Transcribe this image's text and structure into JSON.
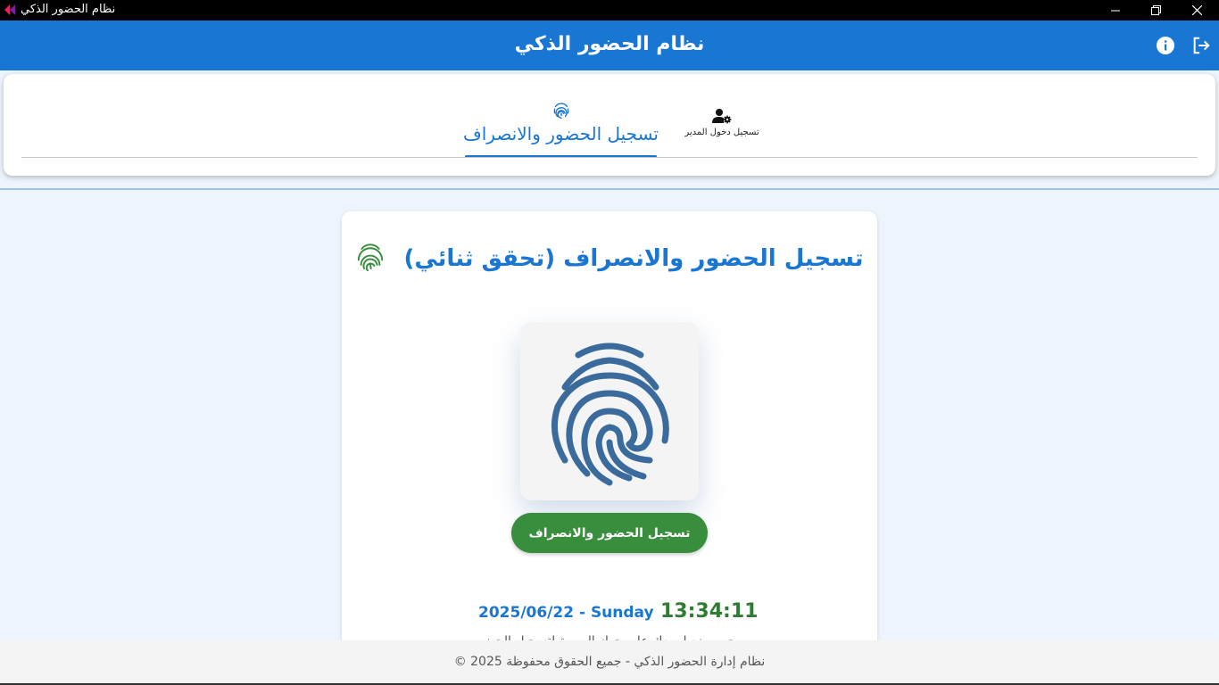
{
  "window": {
    "title": "نظام الحضور الذكي",
    "controls": [
      "minimize-icon",
      "restore-icon",
      "close-icon"
    ]
  },
  "appbar": {
    "title": "نظام الحضور الذكي",
    "actions": [
      "info-icon",
      "logout-icon"
    ],
    "color": "#1976d2"
  },
  "tabs": [
    {
      "label": "تسجيل الحضور والانصراف",
      "icon": "fingerprint-icon",
      "selected": true
    },
    {
      "label": "تسجيل دخول المدير",
      "icon": "user-gear-icon",
      "selected": false
    }
  ],
  "card": {
    "title": "تسجيل الحضور والانصراف (تحقق ثنائي)",
    "title_icon": "fingerprint-icon",
    "scanner_icon": "fingerprint-icon",
    "button_label": "تسجيل الحضور والانصراف",
    "time": "13:34:11",
    "date": "2025/06/22 - Sunday",
    "hint": "يرجى وضع إصبعك على جهاز البصمة لتسجيل الحضور"
  },
  "footer": {
    "text": "نظام إدارة الحضور الذكي - جميع الحقوق محفوظة 2025 ©"
  },
  "colors": {
    "primary": "#1976d2",
    "success": "#388e3c",
    "fingerprint": "#3a6b9c"
  }
}
